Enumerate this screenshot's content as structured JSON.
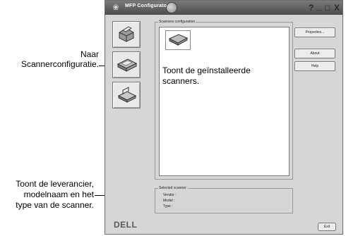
{
  "window": {
    "title": "MFP Configurator",
    "help_glyph": "?",
    "minimize_glyph": "_",
    "maximize_glyph": "□",
    "close_glyph": "X",
    "logo_icon": "app-logo-icon",
    "tab_icon": "scanner-tab-icon"
  },
  "sidebar": {
    "items": [
      {
        "name": "printers-configuration",
        "icon": "printer-icon"
      },
      {
        "name": "scanners-configuration",
        "icon": "scanner-icon"
      },
      {
        "name": "ports-configuration",
        "icon": "port-icon"
      }
    ]
  },
  "scanners_panel": {
    "group_label": "Scanners configuration",
    "scanner_icon": "scanner-icon"
  },
  "buttons": {
    "properties": "Properties...",
    "about": "About",
    "help": "Help",
    "exit": "Exit"
  },
  "selected_scanner": {
    "group_label": "Selected scanner :",
    "vendor_label": "Vendor :",
    "model_label": "Model :",
    "type_label": "Type :"
  },
  "brand": "DELL",
  "annotations": {
    "sidebar_callout_line1": "Naar",
    "sidebar_callout_line2": "Scannerconfiguratie.",
    "list_callout_line1": "Toont de geïnstalleerde",
    "list_callout_line2": "scanners.",
    "info_callout_line1": "Toont de leverancier,",
    "info_callout_line2": "modelnaam en het",
    "info_callout_line3": "type van de scanner."
  }
}
